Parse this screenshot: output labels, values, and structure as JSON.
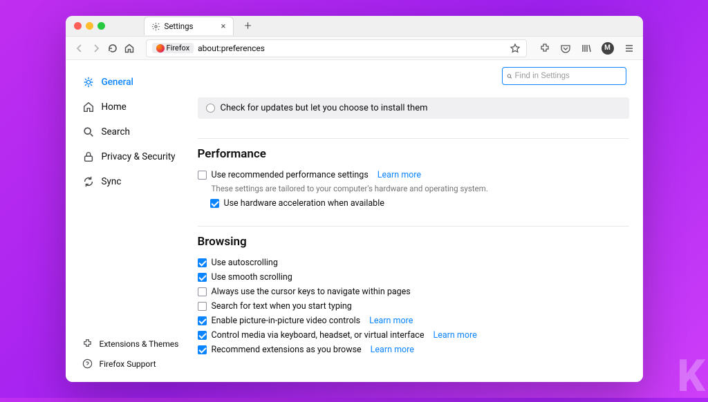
{
  "tab": {
    "title": "Settings"
  },
  "url": {
    "badge": "Firefox",
    "path": "about:preferences"
  },
  "avatar_letter": "M",
  "search": {
    "placeholder": "Find in Settings"
  },
  "sidebar": {
    "items": [
      {
        "label": "General"
      },
      {
        "label": "Home"
      },
      {
        "label": "Search"
      },
      {
        "label": "Privacy & Security"
      },
      {
        "label": "Sync"
      }
    ],
    "bottom": [
      {
        "label": "Extensions & Themes"
      },
      {
        "label": "Firefox Support"
      }
    ]
  },
  "updates": {
    "choice": "Check for updates but let you choose to install them"
  },
  "performance": {
    "heading": "Performance",
    "recommended": "Use recommended performance settings",
    "learn": "Learn more",
    "desc": "These settings are tailored to your computer's hardware and operating system.",
    "hw_accel": "Use hardware acceleration when available"
  },
  "browsing": {
    "heading": "Browsing",
    "auto": "Use autoscrolling",
    "smooth": "Use smooth scrolling",
    "cursor": "Always use the cursor keys to navigate within pages",
    "find": "Search for text when you start typing",
    "pip": "Enable picture-in-picture video controls",
    "media": "Control media via keyboard, headset, or virtual interface",
    "recommend": "Recommend extensions as you browse",
    "learn": "Learn more"
  }
}
